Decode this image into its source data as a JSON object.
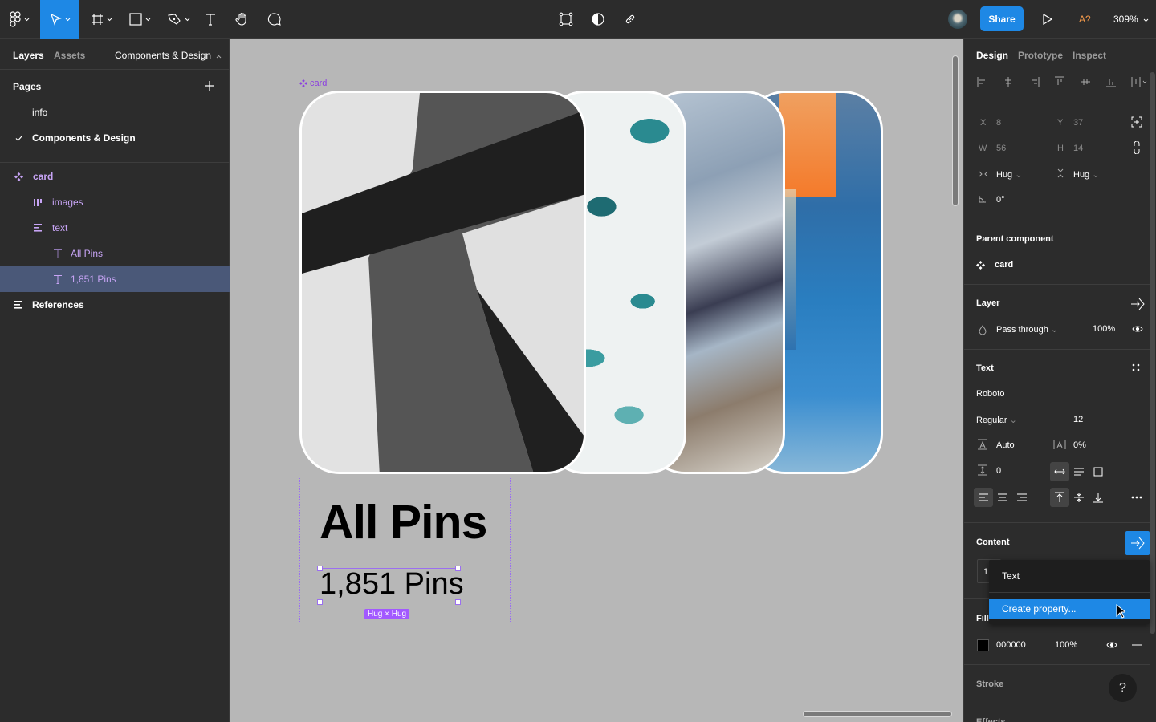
{
  "toolbar": {
    "tools": [
      "main-menu",
      "move-tool",
      "frame-tool",
      "shape-tool",
      "pen-tool",
      "text-tool",
      "hand-tool",
      "comment-tool"
    ],
    "active_tool": "move-tool",
    "center_tools": [
      "transform-icon",
      "contrast-icon",
      "link-icon"
    ],
    "share_label": "Share",
    "a_label": "A?",
    "zoom_level": "309%"
  },
  "left_panel": {
    "tabs": {
      "layers": "Layers",
      "assets": "Assets",
      "page_selector": "Components & Design"
    },
    "pages_title": "Pages",
    "pages": [
      {
        "label": "info",
        "current": false
      },
      {
        "label": "Components & Design",
        "current": true
      }
    ],
    "layers": [
      {
        "label": "card",
        "type": "component",
        "indent": 0
      },
      {
        "label": "images",
        "type": "auto-layout-horizontal",
        "indent": 1
      },
      {
        "label": "text",
        "type": "auto-layout-vertical",
        "indent": 1
      },
      {
        "label": "All Pins",
        "type": "text",
        "indent": 2
      },
      {
        "label": "1,851 Pins",
        "type": "text",
        "indent": 2,
        "selected": true
      },
      {
        "label": "References",
        "type": "frame",
        "indent": 0
      }
    ]
  },
  "canvas": {
    "component_label": "card",
    "heading": "All Pins",
    "count": "1,851 Pins",
    "size_badge": "Hug × Hug",
    "images": [
      "geometric-gray-abstract",
      "ocean-foam",
      "abstract-clouds",
      "blue-orange-painting"
    ]
  },
  "right_panel": {
    "tabs": {
      "design": "Design",
      "prototype": "Prototype",
      "inspect": "Inspect"
    },
    "position": {
      "x_label": "X",
      "x": "8",
      "y_label": "Y",
      "y": "37",
      "w_label": "W",
      "w": "56",
      "h_label": "H",
      "h": "14"
    },
    "resizing": {
      "horizontal": "Hug",
      "vertical": "Hug"
    },
    "rotation": "0°",
    "parent_component": {
      "title": "Parent component",
      "name": "card"
    },
    "layer": {
      "title": "Layer",
      "blend": "Pass through",
      "opacity": "100%"
    },
    "text": {
      "title": "Text",
      "font": "Roboto",
      "weight": "Regular",
      "size": "12",
      "line_height": "Auto",
      "letter_spacing": "0%",
      "paragraph_spacing": "0"
    },
    "content": {
      "title": "Content",
      "value_prefix": "1,"
    },
    "popup": {
      "header": "Text",
      "action": "Create property..."
    },
    "fill": {
      "title": "Fill",
      "color": "000000",
      "opacity": "100%",
      "swatch": "#000000"
    },
    "stroke": {
      "title": "Stroke"
    },
    "effects": {
      "title": "Effects"
    },
    "help_label": "?"
  },
  "colors": {
    "accent": "#1e88e5",
    "component": "#8b3fe0",
    "layer_purple": "#c7a4f5",
    "selection_row": "#4a5878",
    "canvas_bg": "#b7b7b7"
  }
}
